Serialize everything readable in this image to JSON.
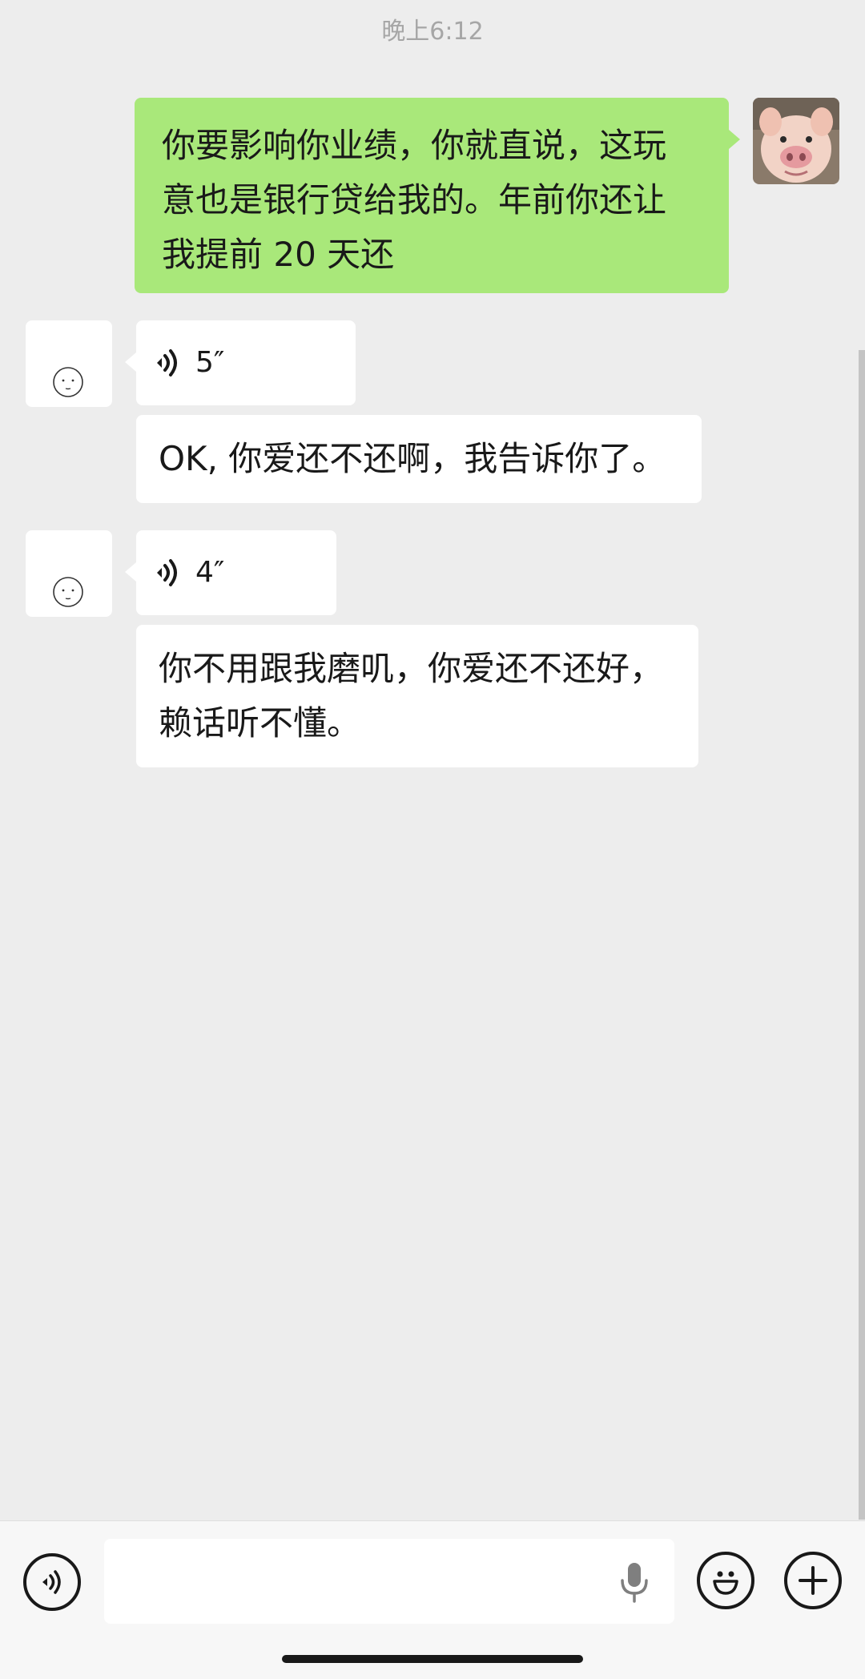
{
  "chat": {
    "timestamp": "晚上6:12",
    "messages": [
      {
        "sender": "me",
        "type": "text",
        "text_lines": [
          "你要影响你业绩，你就直说，这玩",
          "意也是银行贷给我的。年前你还让",
          "我提前 20 天还"
        ]
      },
      {
        "sender": "other",
        "type": "voice",
        "duration": "5″",
        "transcript": "OK, 你爱还不还啊，我告诉你了。"
      },
      {
        "sender": "other",
        "type": "voice",
        "duration": "4″",
        "transcript_lines": [
          "你不用跟我磨叽，你爱还不还好，",
          "赖话听不懂。"
        ]
      }
    ]
  },
  "input_bar": {
    "value": "",
    "placeholder": ""
  },
  "icons": {
    "voice_toggle": "voice-mode-icon",
    "mic": "microphone-icon",
    "emoji": "emoji-icon",
    "plus": "plus-icon",
    "voice_wave": "voice-wave-icon"
  },
  "colors": {
    "background": "#ededed",
    "my_bubble": "#a9e87a",
    "other_bubble": "#ffffff",
    "text": "#191919",
    "timestamp": "#a6a6a6"
  }
}
